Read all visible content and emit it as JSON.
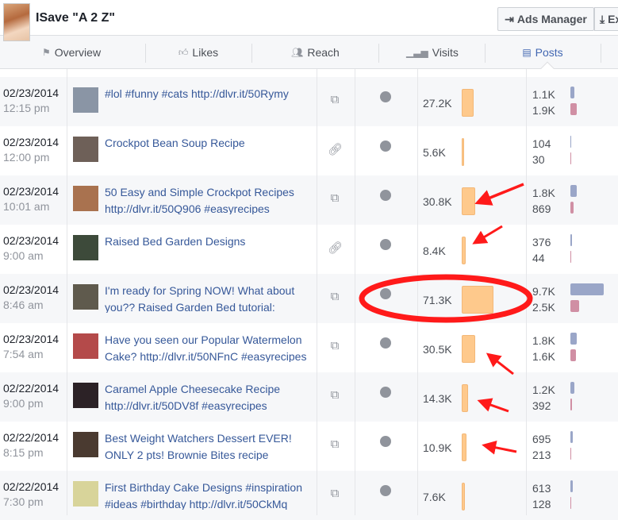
{
  "page": {
    "title": "ISave \"A 2 Z\"",
    "ads_manager": "Ads Manager",
    "export": "Export"
  },
  "tabs": [
    {
      "label": "Overview",
      "icon": "flag-icon"
    },
    {
      "label": "Likes",
      "icon": "thumbs-up-icon"
    },
    {
      "label": "Reach",
      "icon": "people-icon"
    },
    {
      "label": "Visits",
      "icon": "bar-chart-icon"
    },
    {
      "label": "Posts",
      "icon": "posts-list-icon",
      "active": true
    }
  ],
  "colors": {
    "reach_bar": "#fec98c",
    "engagement_top": "#9aa6c8",
    "engagement_bottom": "#d08fa4",
    "link": "#365899",
    "annotation": "#ff1a1a"
  },
  "posts": [
    {
      "date": "02/23/2014",
      "time": "12:15 pm",
      "text": "#lol #funny #cats http://dlvr.it/50Rymy",
      "type": "photo",
      "reach": "27.2K",
      "reach_value": 27200,
      "eng1": "1.1K",
      "eng1_value": 1100,
      "eng2": "1.9K",
      "eng2_value": 1900,
      "thumb": "#8a95a5"
    },
    {
      "date": "02/23/2014",
      "time": "12:00 pm",
      "text": "Crockpot Bean Soup Recipe",
      "type": "link",
      "reach": "5.6K",
      "reach_value": 5600,
      "eng1": "104",
      "eng1_value": 104,
      "eng2": "30",
      "eng2_value": 30,
      "thumb": "#6e6058"
    },
    {
      "date": "02/23/2014",
      "time": "10:01 am",
      "text": "50 Easy and Simple Crockpot Recipes http://dlvr.it/50Q906 #easyrecipes",
      "type": "photo",
      "reach": "30.8K",
      "reach_value": 30800,
      "eng1": "1.8K",
      "eng1_value": 1800,
      "eng2": "869",
      "eng2_value": 869,
      "thumb": "#a9724f"
    },
    {
      "date": "02/23/2014",
      "time": "9:00 am",
      "text": "Raised Bed Garden Designs",
      "type": "link",
      "reach": "8.4K",
      "reach_value": 8400,
      "eng1": "376",
      "eng1_value": 376,
      "eng2": "44",
      "eng2_value": 44,
      "thumb": "#3d4a3a"
    },
    {
      "date": "02/23/2014",
      "time": "8:46 am",
      "text": "I'm ready for Spring NOW! What about you?? Raised Garden Bed tutorial:",
      "type": "photo",
      "reach": "71.3K",
      "reach_value": 71300,
      "eng1": "9.7K",
      "eng1_value": 9700,
      "eng2": "2.5K",
      "eng2_value": 2500,
      "thumb": "#5f5a4d"
    },
    {
      "date": "02/23/2014",
      "time": "7:54 am",
      "text": "Have you seen our Popular Watermelon Cake? http://dlvr.it/50NFnC #easyrecipes",
      "type": "photo",
      "reach": "30.5K",
      "reach_value": 30500,
      "eng1": "1.8K",
      "eng1_value": 1800,
      "eng2": "1.6K",
      "eng2_value": 1600,
      "thumb": "#b44a4a"
    },
    {
      "date": "02/22/2014",
      "time": "9:00 pm",
      "text": "Caramel Apple Cheesecake Recipe http://dlvr.it/50DV8f #easyrecipes",
      "type": "photo",
      "reach": "14.3K",
      "reach_value": 14300,
      "eng1": "1.2K",
      "eng1_value": 1200,
      "eng2": "392",
      "eng2_value": 392,
      "thumb": "#2c2226"
    },
    {
      "date": "02/22/2014",
      "time": "8:15 pm",
      "text": "Best Weight Watchers Dessert EVER! ONLY 2 pts! Brownie Bites recipe",
      "type": "photo",
      "reach": "10.9K",
      "reach_value": 10900,
      "eng1": "695",
      "eng1_value": 695,
      "eng2": "213",
      "eng2_value": 213,
      "thumb": "#4a3a30"
    },
    {
      "date": "02/22/2014",
      "time": "7:30 pm",
      "text": "First Birthday Cake Designs #inspiration #ideas #birthday http://dlvr.it/50CkMq",
      "type": "photo",
      "reach": "7.6K",
      "reach_value": 7600,
      "eng1": "613",
      "eng1_value": 613,
      "eng2": "128",
      "eng2_value": 128,
      "thumb": "#d8d49a"
    }
  ]
}
